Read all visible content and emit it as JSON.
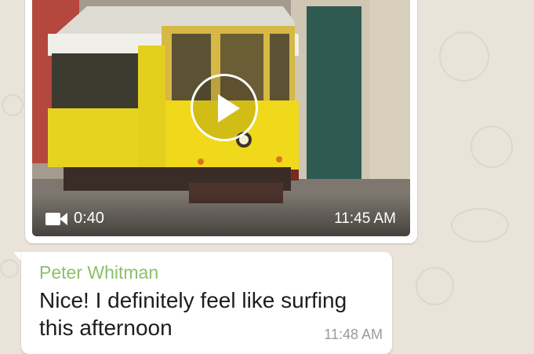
{
  "video_message": {
    "duration": "0:40",
    "timestamp": "11:45 AM",
    "camera_icon": "video-camera-icon",
    "play_icon": "play-icon"
  },
  "text_message": {
    "sender": "Peter Whitman",
    "text": "Nice! I definitely feel like surfing this afternoon",
    "timestamp": "11:48 AM"
  },
  "colors": {
    "sender_name": "#8dbf6a",
    "chat_background": "#e9e3da",
    "bubble": "#ffffff"
  }
}
